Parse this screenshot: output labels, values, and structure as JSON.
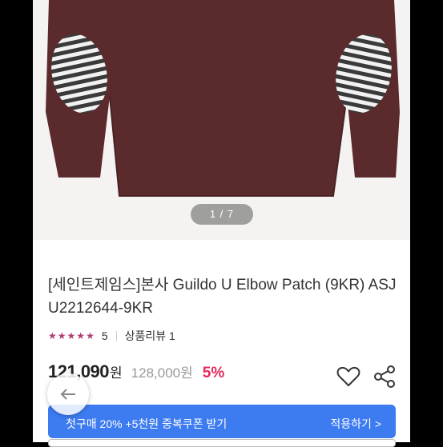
{
  "gallery": {
    "counter": "1 / 7"
  },
  "product": {
    "title": "[세인트제임스]본사 Guildo U Elbow Patch (9KR) ASJU2212644-9KR",
    "rating": "5",
    "review_label": "상품리뷰 1",
    "star_count": 5,
    "price": "121,090",
    "price_unit": "원",
    "original_price": "128,000원",
    "discount": "5%"
  },
  "coupon": {
    "text": "첫구매 20% +5천원 중복쿠폰 받기",
    "link": "적용하기 >"
  },
  "icons": {
    "wishlist": "heart-icon",
    "share": "share-icon",
    "back": "arrow-left-icon"
  },
  "colors": {
    "accent": "#b13e73",
    "discount": "#e5295a",
    "coupon_bg": "#3d7bf0",
    "sweater": "#5a2a2c"
  }
}
